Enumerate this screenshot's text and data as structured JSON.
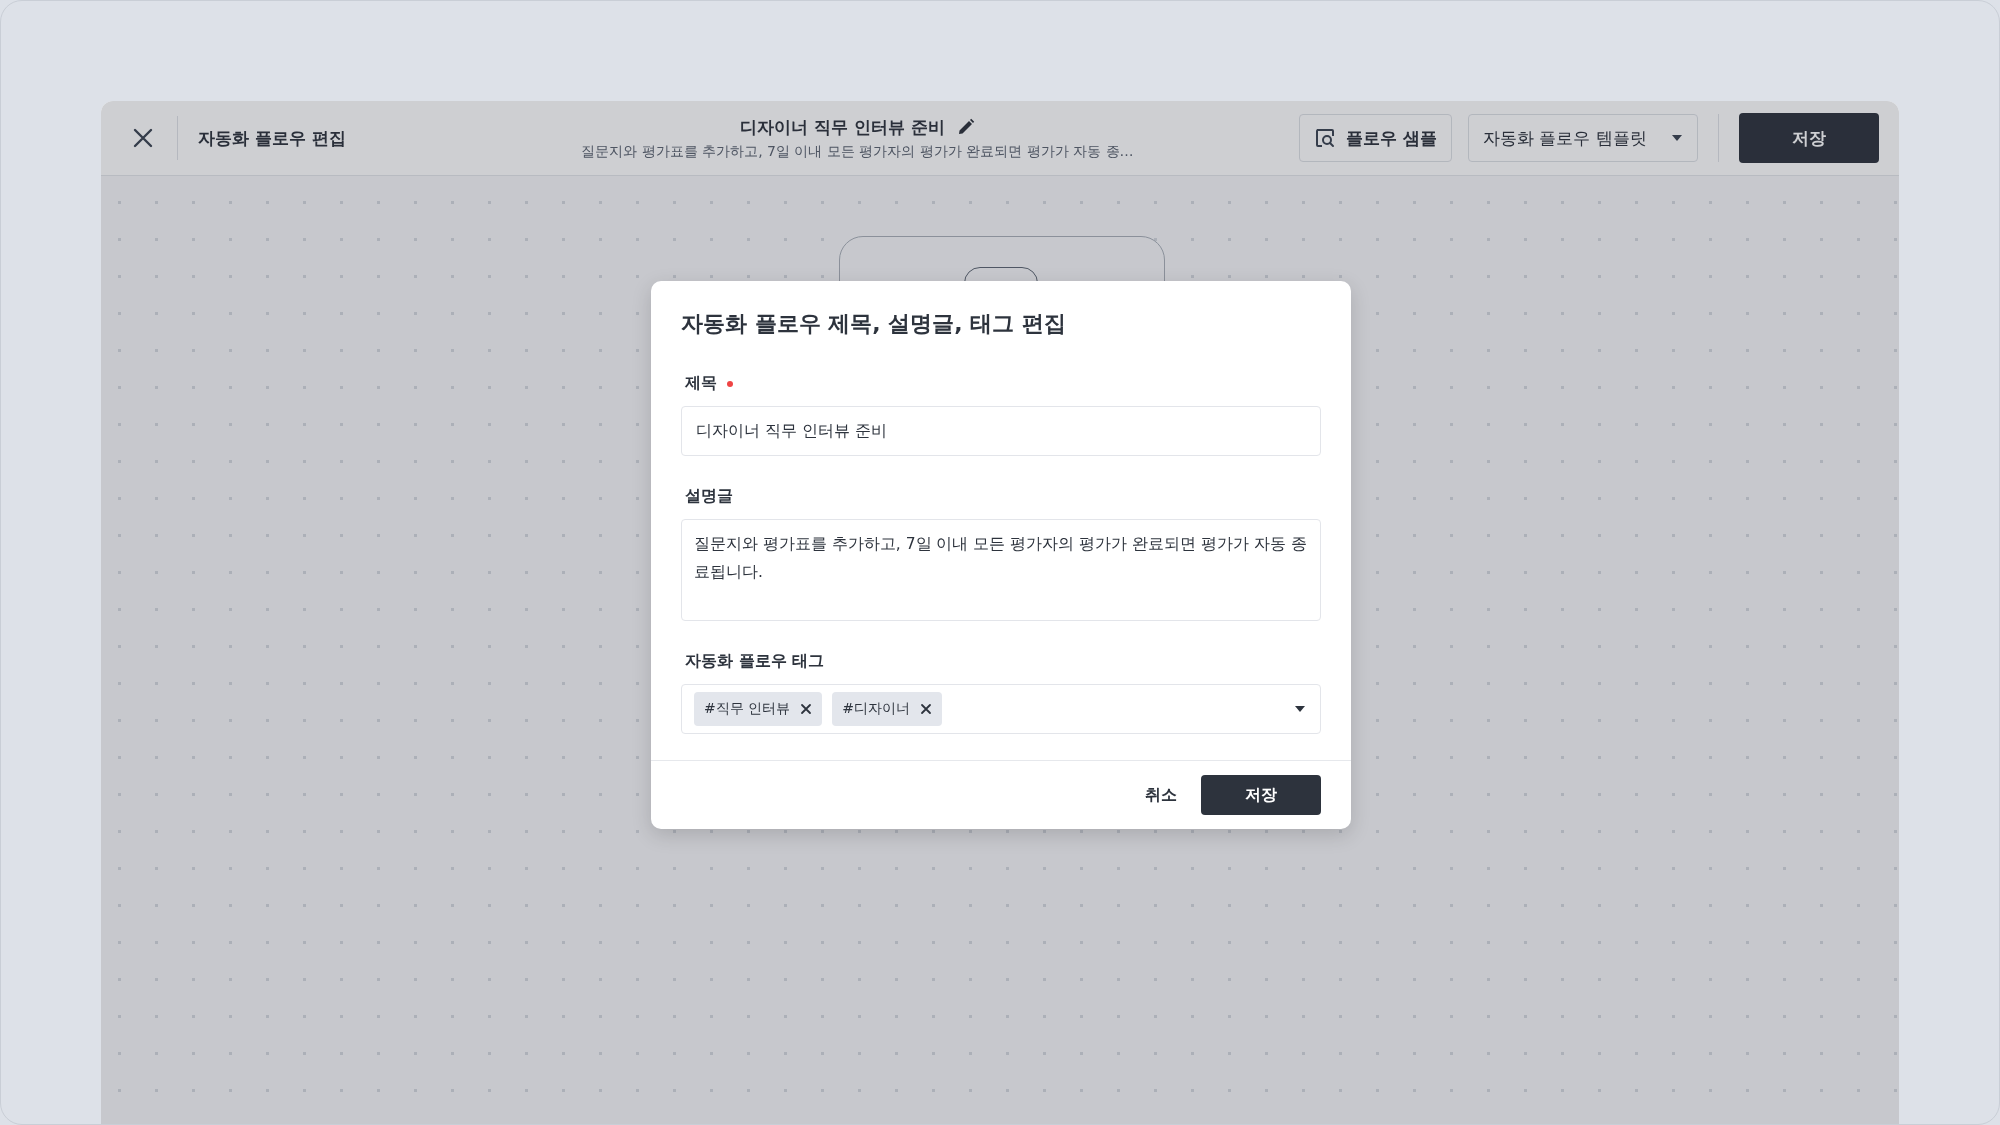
{
  "header": {
    "title": "자동화 플로우 편집",
    "flow_title": "디자이너 직무 인터뷰 준비",
    "flow_description": "질문지와 평가표를 추가하고, 7일 이내 모든 평가자의 평가가 완료되면 평가가 자동 종…",
    "sample_button": "플로우 샘플",
    "template_dropdown": "자동화 플로우 템플릿",
    "save_button": "저장"
  },
  "modal": {
    "title": "자동화 플로우 제목, 설명글, 태그 편집",
    "fields": [
      {
        "kind": "text",
        "label": "제목",
        "required": true,
        "value": "디자이너 직무 인터뷰 준비"
      },
      {
        "kind": "textarea",
        "label": "설명글",
        "required": false,
        "value": "질문지와 평가표를 추가하고, 7일 이내 모든 평가자의 평가가 완료되면 평가가 자동 종료됩니다."
      },
      {
        "kind": "tags",
        "label": "자동화 플로우 태그",
        "required": false,
        "tags": [
          "#직무 인터뷰",
          "#디자이너"
        ]
      }
    ],
    "cancel_button": "취소",
    "save_button": "저장"
  }
}
